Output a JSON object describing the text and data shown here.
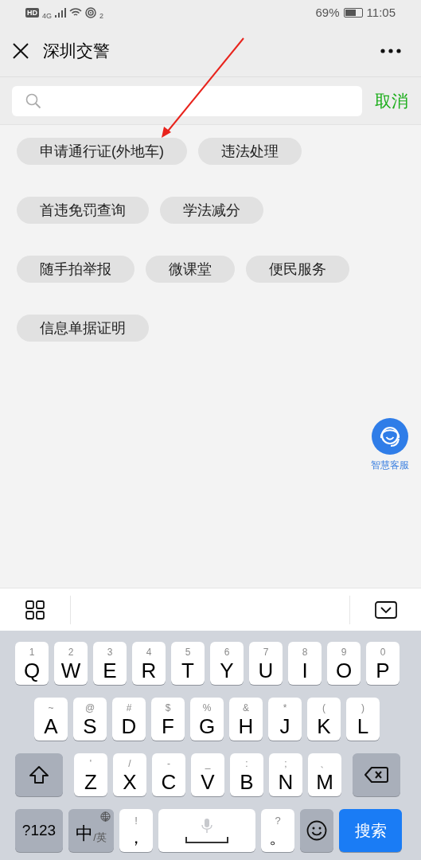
{
  "status_bar": {
    "hd_badge": "HD",
    "network_label": "4G",
    "hotspot_label": "2",
    "battery_text": "69%",
    "time": "11:05"
  },
  "nav": {
    "title": "深圳交警"
  },
  "search": {
    "cancel": "取消"
  },
  "quick_link_rows": [
    [
      "申请通行证(外地车)",
      "违法处理"
    ],
    [
      "首违免罚查询",
      "学法减分"
    ],
    [
      "随手拍举报",
      "微课堂",
      "便民服务"
    ],
    [
      "信息单据证明"
    ]
  ],
  "assistant": {
    "label": "智慧客服"
  },
  "keyboard": {
    "row_1": [
      {
        "kind": "letter",
        "label": "Q",
        "hint": "1"
      },
      {
        "kind": "letter",
        "label": "W",
        "hint": "2"
      },
      {
        "kind": "letter",
        "label": "E",
        "hint": "3"
      },
      {
        "kind": "letter",
        "label": "R",
        "hint": "4"
      },
      {
        "kind": "letter",
        "label": "T",
        "hint": "5"
      },
      {
        "kind": "letter",
        "label": "Y",
        "hint": "6"
      },
      {
        "kind": "letter",
        "label": "U",
        "hint": "7"
      },
      {
        "kind": "letter",
        "label": "I",
        "hint": "8"
      },
      {
        "kind": "letter",
        "label": "O",
        "hint": "9"
      },
      {
        "kind": "letter",
        "label": "P",
        "hint": "0"
      }
    ],
    "row_2": [
      {
        "kind": "letter",
        "label": "A",
        "hint": "~"
      },
      {
        "kind": "letter",
        "label": "S",
        "hint": "@"
      },
      {
        "kind": "letter",
        "label": "D",
        "hint": "#"
      },
      {
        "kind": "letter",
        "label": "F",
        "hint": "$"
      },
      {
        "kind": "letter",
        "label": "G",
        "hint": "%"
      },
      {
        "kind": "letter",
        "label": "H",
        "hint": "&"
      },
      {
        "kind": "letter",
        "label": "J",
        "hint": "*"
      },
      {
        "kind": "letter",
        "label": "K",
        "hint": "("
      },
      {
        "kind": "letter",
        "label": "L",
        "hint": ")"
      }
    ],
    "row_3": [
      {
        "kind": "shift"
      },
      {
        "kind": "letter",
        "label": "Z",
        "hint": "'"
      },
      {
        "kind": "letter",
        "label": "X",
        "hint": "/"
      },
      {
        "kind": "letter",
        "label": "C",
        "hint": "-"
      },
      {
        "kind": "letter",
        "label": "V",
        "hint": "_"
      },
      {
        "kind": "letter",
        "label": "B",
        "hint": ":"
      },
      {
        "kind": "letter",
        "label": "N",
        "hint": ";"
      },
      {
        "kind": "letter",
        "label": "M",
        "hint": "、"
      },
      {
        "kind": "delete"
      }
    ],
    "row_4": [
      {
        "kind": "symbols",
        "label": "?123"
      },
      {
        "kind": "language",
        "label": "中",
        "sub": "/英"
      },
      {
        "kind": "punct",
        "label": "，",
        "hint": "!"
      },
      {
        "kind": "space"
      },
      {
        "kind": "punct",
        "label": "。",
        "hint": "?"
      },
      {
        "kind": "emoji"
      },
      {
        "kind": "action",
        "label": "搜索"
      }
    ]
  }
}
